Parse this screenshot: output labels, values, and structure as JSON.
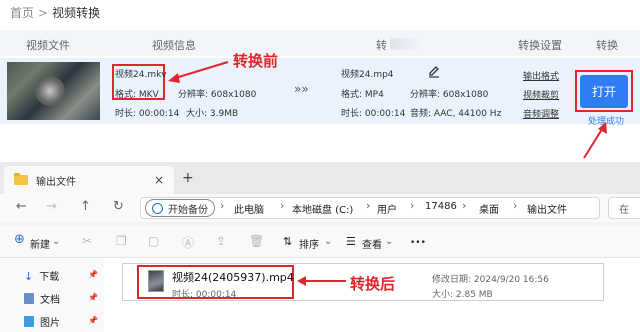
{
  "breadcrumb": {
    "home": "首页",
    "separator": ">",
    "current": "视频转换"
  },
  "table_headers": {
    "video_file": "视频文件",
    "video_info": "视频信息",
    "convert_partial": "转",
    "convert_settings": "转换设置",
    "convert": "转换"
  },
  "source": {
    "name": "视频24.mkv",
    "format": "格式: MKV",
    "resolution": "分辨率: 608x1080",
    "duration": "时长: 00:00:14",
    "size": "大小: 3.9MB"
  },
  "target": {
    "name": "视频24.mp4",
    "format": "格式: MP4",
    "resolution": "分辨率: 608x1080",
    "duration": "时长: 00:00:14",
    "audio": "音频: AAC, 44100 Hz"
  },
  "arrow_glyph": "»»",
  "settings_links": [
    "输出格式",
    "视频裁剪",
    "音频调整"
  ],
  "open_button": "打开",
  "status": "处理成功",
  "annotations": {
    "before": "转换前",
    "after": "转换后"
  },
  "explorer": {
    "tab_title": "输出文件",
    "tab_close": "×",
    "new_tab": "+",
    "backup_pill": "开始备份",
    "path": [
      "此电脑",
      "本地磁盘 (C:)",
      "用户",
      "17486",
      "桌面",
      "输出文件"
    ],
    "search_partial": "在",
    "toolbar": {
      "new": "新建",
      "sort": "排序",
      "view": "查看",
      "more": "•••"
    },
    "sidebar": [
      "下载",
      "文档",
      "图片"
    ],
    "file": {
      "name": "视频24(2405937).mp4",
      "duration": "时长: 00:00:14",
      "modified": "修改日期: 2024/9/20 16:56",
      "size": "大小: 2.85 MB"
    }
  },
  "colors": {
    "accent": "#2f7cf5",
    "annotation_red": "#e0262d",
    "row_bg": "#eaf3fd"
  }
}
